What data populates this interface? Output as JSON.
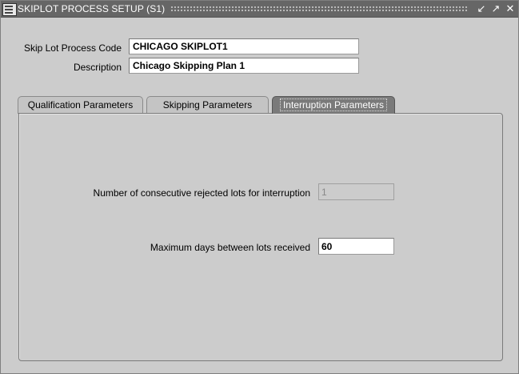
{
  "window": {
    "title": "SKIPLOT PROCESS SETUP (S1)",
    "icons": [
      "app-menu-icon",
      "minimize-icon",
      "maximize-icon",
      "close-icon"
    ]
  },
  "header": {
    "process_code_label": "Skip Lot Process Code",
    "process_code_value": "CHICAGO SKIPLOT1",
    "description_label": "Description",
    "description_value": "Chicago Skipping Plan 1"
  },
  "tabs": [
    {
      "label": "Qualification Parameters",
      "active": false
    },
    {
      "label": "Skipping Parameters",
      "active": false
    },
    {
      "label": "Interruption Parameters",
      "active": true
    }
  ],
  "interruption": {
    "rejected_lots_label": "Number of consecutive rejected lots for interruption",
    "rejected_lots_value": "1",
    "max_days_label": "Maximum days between lots received",
    "max_days_value": "60"
  }
}
